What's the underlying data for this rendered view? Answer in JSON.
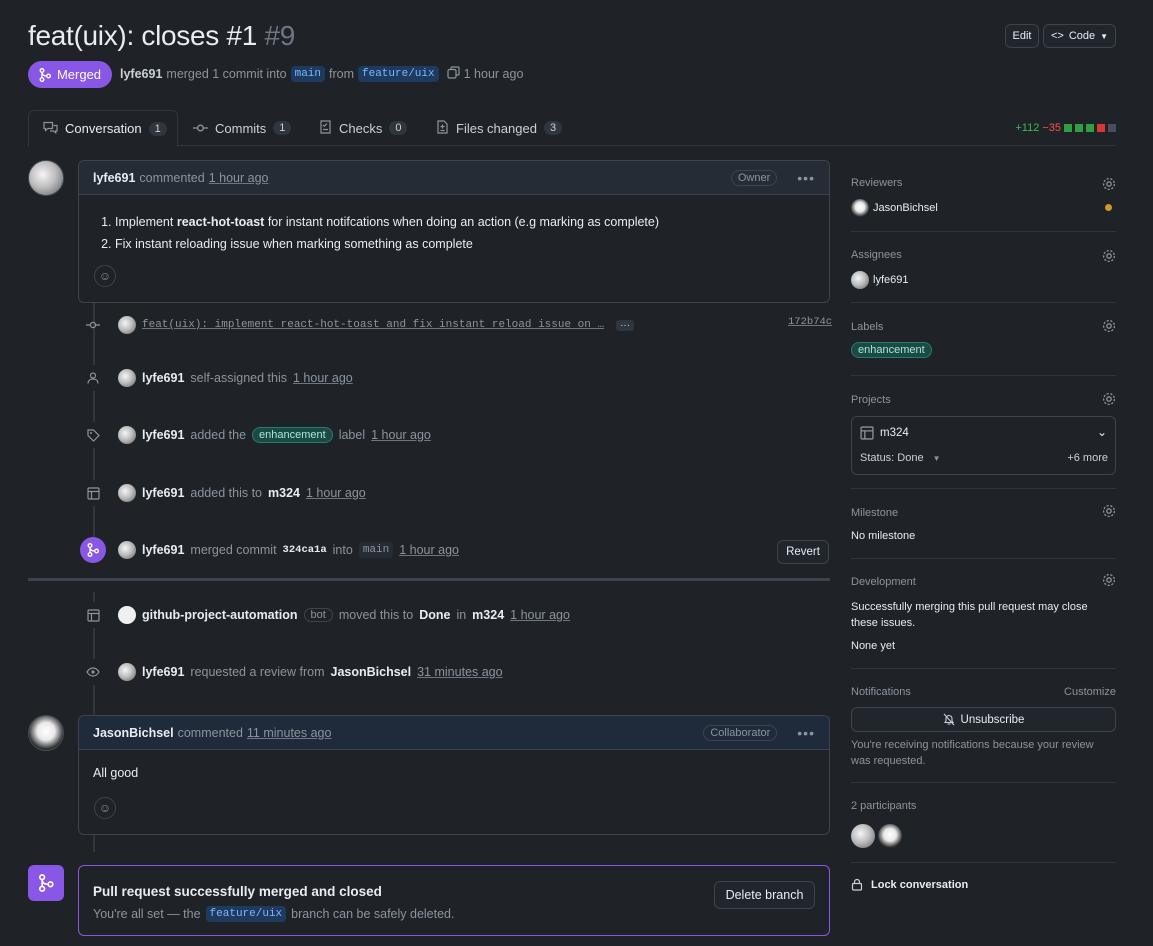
{
  "header": {
    "title": "feat(uix): closes #1",
    "number": "#9",
    "edit_label": "Edit",
    "code_label": "Code"
  },
  "status": {
    "state": "Merged",
    "author": "lyfe691",
    "action": "merged 1 commit into",
    "base_branch": "main",
    "from_word": "from",
    "head_branch": "feature/uix",
    "time": "1 hour ago"
  },
  "tabs": [
    {
      "label": "Conversation",
      "count": "1"
    },
    {
      "label": "Commits",
      "count": "1"
    },
    {
      "label": "Checks",
      "count": "0"
    },
    {
      "label": "Files changed",
      "count": "3"
    }
  ],
  "diffstat": {
    "additions": "+112",
    "deletions": "−35"
  },
  "comment1": {
    "author": "lyfe691",
    "verb": "commented",
    "time": "1 hour ago",
    "role": "Owner",
    "items": [
      {
        "prefix": "Implement ",
        "bold": "react-hot-toast",
        "suffix": " for instant notifcations when doing an action (e.g marking as complete)"
      },
      {
        "prefix": "Fix instant reloading issue when marking something as complete",
        "bold": "",
        "suffix": ""
      }
    ]
  },
  "commit_event": {
    "message": "feat(uix): implement react-hot-toast and fix instant reload issue on …",
    "sha": "172b74c"
  },
  "events": {
    "self_assigned": {
      "user": "lyfe691",
      "text": "self-assigned this",
      "time": "1 hour ago"
    },
    "labeled": {
      "user": "lyfe691",
      "text1": "added the",
      "label": "enhancement",
      "text2": "label",
      "time": "1 hour ago"
    },
    "project": {
      "user": "lyfe691",
      "text": "added this to",
      "project": "m324",
      "time": "1 hour ago"
    },
    "merged": {
      "user": "lyfe691",
      "text1": "merged commit",
      "sha": "324ca1a",
      "text2": "into",
      "branch": "main",
      "time": "1 hour ago",
      "revert_label": "Revert"
    },
    "moved": {
      "user": "github-project-automation",
      "badge": "bot",
      "text1": "moved this to",
      "status": "Done",
      "text2": "in",
      "project": "m324",
      "time": "1 hour ago"
    },
    "review_req": {
      "user": "lyfe691",
      "text": "requested a review from",
      "reviewer": "JasonBichsel",
      "time": "31 minutes ago"
    }
  },
  "comment2": {
    "author": "JasonBichsel",
    "verb": "commented",
    "time": "11 minutes ago",
    "role": "Collaborator",
    "body": "All good"
  },
  "merge_box": {
    "title": "Pull request successfully merged and closed",
    "text1": "You're all set — the",
    "branch": "feature/uix",
    "text2": "branch can be safely deleted.",
    "delete_label": "Delete branch"
  },
  "sidebar": {
    "reviewers": {
      "heading": "Reviewers",
      "name": "JasonBichsel"
    },
    "assignees": {
      "heading": "Assignees",
      "name": "lyfe691"
    },
    "labels": {
      "heading": "Labels",
      "label": "enhancement"
    },
    "projects": {
      "heading": "Projects",
      "name": "m324",
      "status": "Status: Done",
      "more": "+6 more"
    },
    "milestone": {
      "heading": "Milestone",
      "value": "No milestone"
    },
    "development": {
      "heading": "Development",
      "text": "Successfully merging this pull request may close these issues.",
      "none": "None yet"
    },
    "notifications": {
      "heading": "Notifications",
      "customize": "Customize",
      "button": "Unsubscribe",
      "text": "You're receiving notifications because your review was requested."
    },
    "participants": {
      "heading": "2 participants"
    },
    "lock": {
      "label": "Lock conversation"
    }
  },
  "colors": {
    "merged": "#8957e5",
    "label_bg": "#1b4a44",
    "reviewer_dot": "#d29922"
  }
}
